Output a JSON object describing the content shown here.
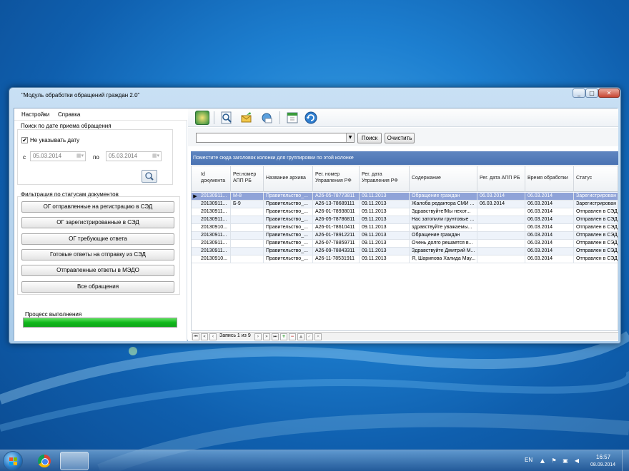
{
  "window": {
    "title": "\"Модуль обработки обращений граждан 2.0\"",
    "controls": {
      "minimize": "_",
      "maximize": "□",
      "close": "✕"
    }
  },
  "menu": {
    "items": [
      {
        "label": "Настройки"
      },
      {
        "label": "Справка"
      }
    ]
  },
  "date_search": {
    "group_label": "Поиск по дате приема обращения",
    "no_date_label": "Не указывать дату",
    "no_date_checked": true,
    "from_label": "с",
    "from_value": "05.03.2014",
    "to_label": "по",
    "to_value": "05.03.2014"
  },
  "status_filter": {
    "group_label": "Фильтрация по статусам документов",
    "buttons": [
      {
        "label": "ОГ отправленные на регистрацию в СЭД"
      },
      {
        "label": "ОГ зарегистрированные в СЭД"
      },
      {
        "label": "ОГ требующие ответа"
      },
      {
        "label": "Готовые ответы на отправку из СЭД"
      },
      {
        "label": "Отправленные ответы в МЭДО"
      },
      {
        "label": "Все обращения"
      }
    ]
  },
  "progress": {
    "label": "Процесс выполнения",
    "fraction": 1.0
  },
  "toolbar": {
    "icons": [
      "sed-logo-icon",
      "search-doc-icon",
      "envelope-arrow-icon",
      "network-mail-icon",
      "calendar-icon",
      "refresh-icon"
    ]
  },
  "filter": {
    "search_label": "Поиск",
    "clear_label": "Очистить",
    "combo_value": ""
  },
  "group_panel": {
    "text": "Поместите сюда заголовок колонки для группировки по этой колонке"
  },
  "grid": {
    "columns": [
      {
        "label": "Id документа"
      },
      {
        "label": "Рег.номер АПП РБ"
      },
      {
        "label": "Название архива"
      },
      {
        "label": "Рег. номер Управления РФ"
      },
      {
        "label": "Рег. дата Управления РФ"
      },
      {
        "label": "Содержание"
      },
      {
        "label": "Рег. дата АПП РБ"
      },
      {
        "label": "Время обработки"
      },
      {
        "label": "Статус"
      }
    ],
    "rows": [
      [
        "20130911...",
        "М-8",
        "Правительство_...",
        "А26-05-78773811",
        "09.11.2013",
        "Обращение граждан",
        "06.03.2014",
        "06.03.2014",
        "Зарегистрирован ..."
      ],
      [
        "20130911...",
        "Б-9",
        "Правительство_...",
        "А26-13-78689111",
        "09.11.2013",
        "Жалоба редактора СМИ ...",
        "06.03.2014",
        "06.03.2014",
        "Зарегистрирован ..."
      ],
      [
        "20130911...",
        "",
        "Правительство_...",
        "А26-01-78938011",
        "09.11.2013",
        "Здравствуйте!Мы нехот...",
        "",
        "06.03.2014",
        "Отправлен в СЭД ..."
      ],
      [
        "20130911...",
        "",
        "Правительство_...",
        "А26-05-78786811",
        "09.11.2013",
        "Нас затопили грунтовые ...",
        "",
        "06.03.2014",
        "Отправлен в СЭД ..."
      ],
      [
        "20130910...",
        "",
        "Правительство_...",
        "А26-01-78610411",
        "09.11.2013",
        "здравствуйте уважаемы...",
        "",
        "06.03.2014",
        "Отправлен в СЭД ..."
      ],
      [
        "20130911...",
        "",
        "Правительство_...",
        "А26-01-78912211",
        "09.11.2013",
        "Обращение граждан",
        "",
        "06.03.2014",
        "Отправлен в СЭД ..."
      ],
      [
        "20130911...",
        "",
        "Правительство_...",
        "А26-07-78859711",
        "09.11.2013",
        "Очень долго решается в...",
        "",
        "06.03.2014",
        "Отправлен в СЭД ..."
      ],
      [
        "20130911...",
        "",
        "Правительство_...",
        "А26-09-78843311",
        "09.11.2013",
        "Здравствуйте Дмитрий М...",
        "",
        "06.03.2014",
        "Отправлен в СЭД ..."
      ],
      [
        "20130910...",
        "",
        "Правительство_...",
        "А26-11-78531911",
        "09.11.2013",
        "Я, Шарипова Халида Мау...",
        "",
        "06.03.2014",
        "Отправлен в СЭД ..."
      ]
    ],
    "selected_row": 0,
    "navigator_text": "Запись 1 из 9"
  },
  "taskbar": {
    "language": "EN",
    "time": "16:57",
    "date": "08.09.2014"
  },
  "colors": {
    "accent_blue": "#4a73b3",
    "progress_green": "#10b81b",
    "selected_row": "#8fa3d8"
  }
}
